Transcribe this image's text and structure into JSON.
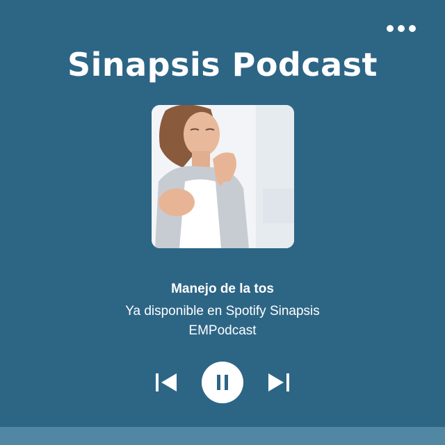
{
  "header": {
    "title": "Sinapsis Podcast",
    "menu_icon": "more-dots-icon"
  },
  "cover": {
    "icon": "episode-cover-image"
  },
  "track": {
    "title": "Manejo de la tos",
    "subtitle": "Ya disponible en Spotify Sinapsis EMPodcast"
  },
  "controls": {
    "previous_icon": "skip-previous-icon",
    "pause_icon": "pause-icon",
    "next_icon": "skip-next-icon"
  },
  "colors": {
    "background": "#2d6585",
    "bottom_bar": "#5287a3",
    "foreground": "#ffffff"
  }
}
